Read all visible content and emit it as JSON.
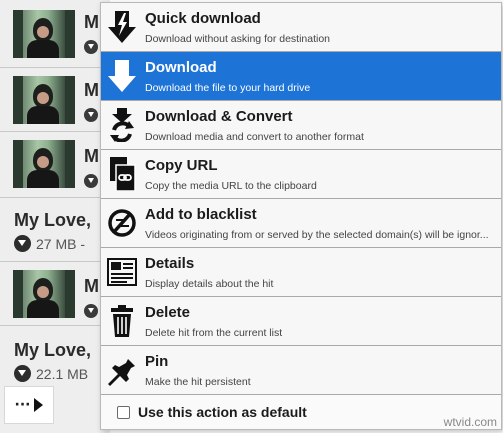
{
  "background_list": {
    "rows": [
      {
        "title": "M"
      },
      {
        "title": "M"
      },
      {
        "title": "M"
      },
      {
        "title": "My Love,",
        "size": "27 MB -"
      },
      {
        "title": "M"
      },
      {
        "title": "My Love,",
        "size": "22.1 MB"
      }
    ],
    "more_label": "···"
  },
  "menu": {
    "items": [
      {
        "label": "Quick download",
        "desc": "Download without asking for destination",
        "icon": "quick-download-icon"
      },
      {
        "label": "Download",
        "desc": "Download the file to your hard drive",
        "icon": "download-arrow-icon",
        "selected": true
      },
      {
        "label": "Download & Convert",
        "desc": "Download media and convert to another format",
        "icon": "convert-icon"
      },
      {
        "label": "Copy URL",
        "desc": "Copy the media URL to the clipboard",
        "icon": "copy-url-icon"
      },
      {
        "label": "Add to blacklist",
        "desc": "Videos originating from or served by the selected domain(s) will be ignor...",
        "icon": "blacklist-icon"
      },
      {
        "label": "Details",
        "desc": "Display details about the hit",
        "icon": "details-icon"
      },
      {
        "label": "Delete",
        "desc": "Delete hit from the current list",
        "icon": "trash-icon"
      },
      {
        "label": "Pin",
        "desc": "Make the hit persistent",
        "icon": "pin-icon"
      }
    ],
    "default_checkbox": {
      "label": "Use this action as default",
      "checked": false
    }
  },
  "watermark": "wtvid.com",
  "colors": {
    "selected": "#1e73d6",
    "menu_bg": "#f7f7f7"
  }
}
